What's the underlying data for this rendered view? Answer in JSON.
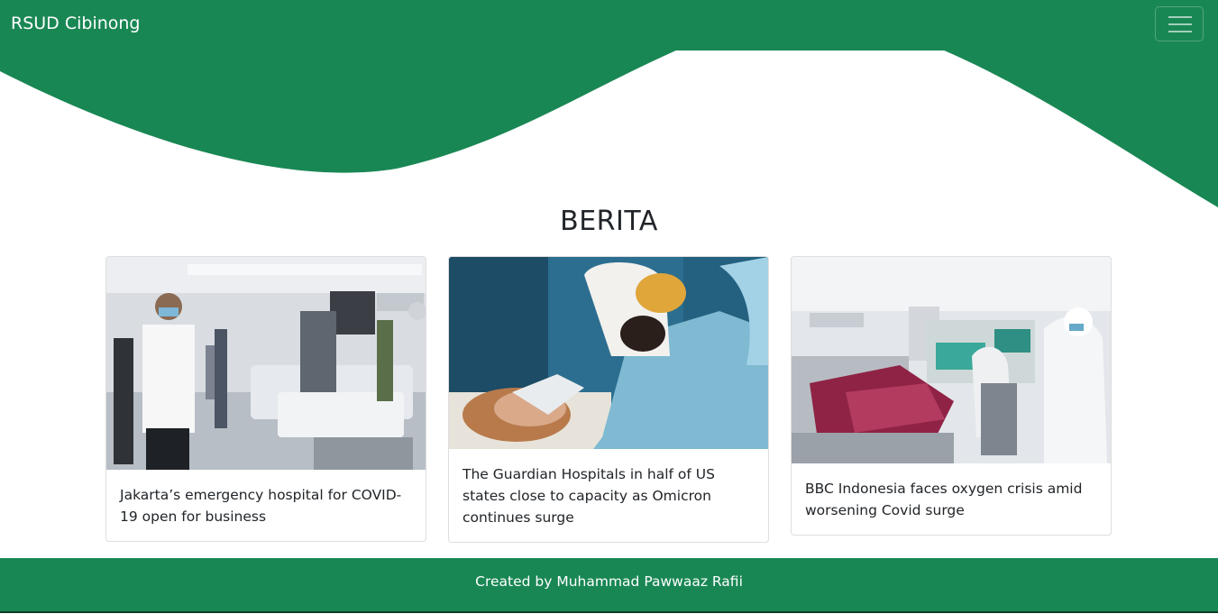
{
  "navbar": {
    "brand": "RSUD Cibinong",
    "toggle_icon": "hamburger-menu-icon"
  },
  "section": {
    "title": "BERITA"
  },
  "cards": [
    {
      "text": "Jakarta’s emergency hospital for COVID-19 open for business"
    },
    {
      "text": "The Guardian Hospitals in half of US states close to capacity as Omicron continues surge"
    },
    {
      "text": "BBC Indonesia faces oxygen crisis amid worsening Covid surge"
    }
  ],
  "footer": {
    "text": "Created by Muhammad Pawwaaz Rafii"
  },
  "colors": {
    "primary": "#198754",
    "background": "#ffffff",
    "text": "#212529"
  }
}
